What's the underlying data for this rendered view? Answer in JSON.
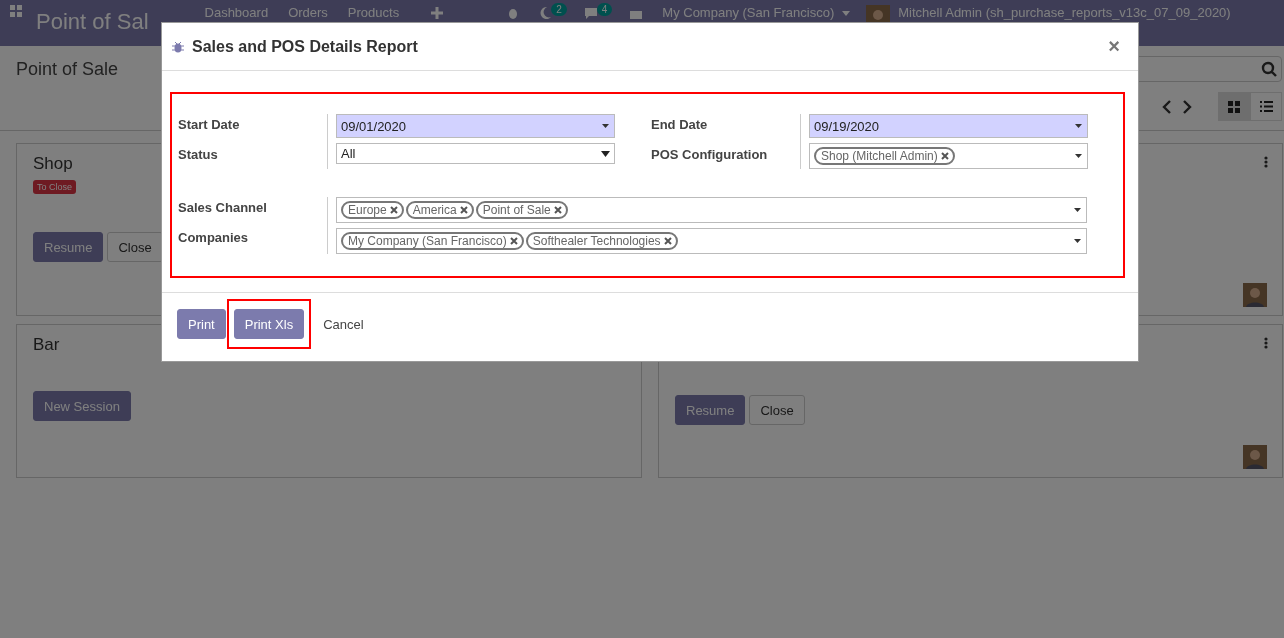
{
  "navbar": {
    "app_title": "Point of Sal",
    "menu": [
      "Dashboard",
      "Orders",
      "Products"
    ],
    "activity_count": "2",
    "message_count": "4",
    "company": "My Company (San Francisco)",
    "user": "Mitchell Admin (sh_purchase_reports_v13c_07_09_2020)"
  },
  "control_panel": {
    "title": "Point of Sale",
    "views": [
      {
        "kind": "kanban",
        "selected": true
      },
      {
        "kind": "list",
        "selected": false
      }
    ]
  },
  "cards": [
    {
      "name": "Shop",
      "badge": "To Close",
      "buttons": [
        {
          "label": "Resume",
          "kind": "primary"
        },
        {
          "label": "Close",
          "kind": "secondary"
        }
      ]
    },
    {
      "avatar": true
    },
    {
      "name": "Bar",
      "buttons": [
        {
          "label": "New Session",
          "kind": "primary"
        }
      ]
    },
    {
      "avatar": true,
      "buttons": [
        {
          "label": "Resume",
          "kind": "primary"
        },
        {
          "label": "Close",
          "kind": "secondary"
        }
      ]
    }
  ],
  "dialog": {
    "title": "Sales and POS Details Report",
    "close_label": "×",
    "form_highlighted": true,
    "left_fields": [
      {
        "label": "Start Date",
        "kind": "date",
        "value": "09/01/2020"
      },
      {
        "label": "Status",
        "kind": "select",
        "value": "All"
      }
    ],
    "right_fields": [
      {
        "label": "End Date",
        "kind": "date",
        "value": "09/19/2020"
      },
      {
        "label": "POS Configuration",
        "kind": "tags",
        "tags": [
          "Shop (Mitchell Admin)"
        ]
      }
    ],
    "wide_fields": [
      {
        "label": "Sales Channel",
        "kind": "tags",
        "tags": [
          "Europe",
          "America",
          "Point of Sale"
        ]
      },
      {
        "label": "Companies",
        "kind": "tags",
        "tags": [
          "My Company (San Francisco)",
          "Softhealer Technologies"
        ]
      }
    ],
    "buttons": [
      {
        "label": "Print",
        "kind": "primary",
        "highlighted": false
      },
      {
        "label": "Print Xls",
        "kind": "primary",
        "highlighted": true
      },
      {
        "label": "Cancel",
        "kind": "link",
        "highlighted": false
      }
    ]
  }
}
